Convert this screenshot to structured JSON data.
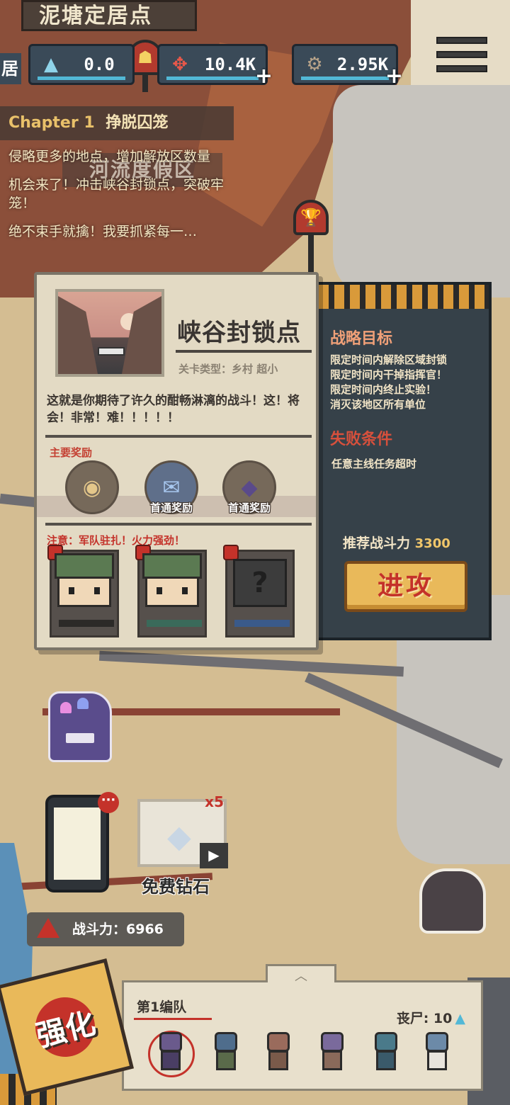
{
  "header": {
    "location_title": "泥塘定居点",
    "side_label": "居",
    "resources": [
      {
        "icon": "triangle-crystal-icon",
        "value": "0.0",
        "addable": false
      },
      {
        "icon": "parts-icon",
        "value": "10.4K",
        "addable": true
      },
      {
        "icon": "gear-icon",
        "value": "2.95K",
        "addable": true
      }
    ]
  },
  "quest_log": {
    "chapter_prefix": "Chapter 1",
    "chapter_title": "挣脱囚笼",
    "entries": [
      "侵略更多的地点，增加解放区数量",
      "机会来了！冲击峡谷封锁点，突破牢笼！",
      "绝不束手就擒！我要抓紧每一…"
    ],
    "zone_sign": "河流度假区"
  },
  "stage": {
    "name": "峡谷封锁点",
    "type": "关卡类型：乡村 超小",
    "description": "这就是你期待了许久的酣畅淋漓的战斗！这！将会！非常！难！！！！！",
    "rewards_label": "主要奖励",
    "rewards": [
      {
        "icon": "coin-reward-icon",
        "tag": ""
      },
      {
        "icon": "blueprint-scroll-icon",
        "tag": "首通奖励"
      },
      {
        "icon": "purple-gem-icon",
        "tag": "首通奖励"
      }
    ],
    "warning": "注意：军队驻扎！火力强劲！",
    "enemies": [
      {
        "kind": "rifle-soldier",
        "known": true
      },
      {
        "kind": "gatling-soldier",
        "known": true
      },
      {
        "kind": "unknown-soldier",
        "known": false,
        "mark": "?"
      }
    ]
  },
  "objectives": {
    "title": "战略目标",
    "items": [
      "限定时间内解除区域封锁",
      "限定时间内干掉指挥官！",
      "限定时间内终止实验！",
      "消灭该地区所有单位"
    ],
    "fail_title": "失败条件",
    "fail_text": "任意主线任务超时",
    "recommended_label": "推荐战斗力",
    "recommended_value": "3300",
    "attack_label": "进攻"
  },
  "lower": {
    "phone_notif": "···",
    "free_gem_multiplier": "x5",
    "free_gem_label": "免费钻石",
    "power_label": "战斗力：6966"
  },
  "squad": {
    "title": "第1编队",
    "zombie_count_label": "丧尸: 10",
    "units": [
      {
        "name": "purple-zombie",
        "color": "#6a5a8c",
        "selected": true
      },
      {
        "name": "blue-zombie",
        "color": "#4f6d8c",
        "selected": false
      },
      {
        "name": "cat-zombie",
        "color": "#9a6b5c",
        "selected": false
      },
      {
        "name": "hat-zombie",
        "color": "#7a6a9c",
        "selected": false
      },
      {
        "name": "spiky-zombie",
        "color": "#4a7a8a",
        "selected": false
      },
      {
        "name": "big-zombie",
        "color": "#6c8aa8",
        "selected": false
      }
    ]
  },
  "upgrade_label": "强化",
  "colors": {
    "accent_red": "#c4322a",
    "attack_gold": "#e9b95a",
    "panel_dark": "#364149",
    "card_paper": "#e3dac4"
  }
}
